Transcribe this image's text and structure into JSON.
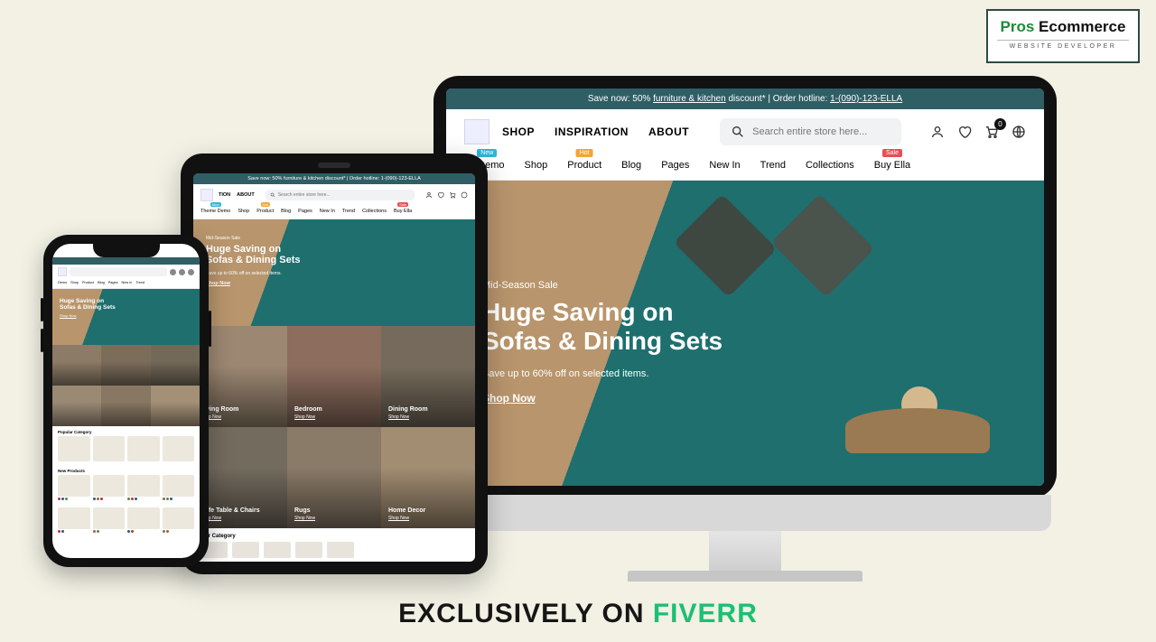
{
  "brand": {
    "word1": "Pros",
    "word2": " Ecommerce",
    "sub": "WEBSITE DEVELOPER"
  },
  "footer": {
    "pre": "EXCLUSIVELY ON ",
    "brand": "FIVERR"
  },
  "promo": {
    "pre": "Save now: 50% ",
    "link": "furniture & kitchen",
    "post": " discount* | Order hotline: ",
    "phone": "1-(090)-123-ELLA"
  },
  "nav": {
    "shop": "SHOP",
    "inspiration": "INSPIRATION",
    "about": "ABOUT"
  },
  "search": {
    "placeholder": "Search entire store here..."
  },
  "cart": {
    "count": "0"
  },
  "subnav": {
    "demo": "e Demo",
    "demo_badge": "New",
    "shop": "Shop",
    "product": "Product",
    "product_badge": "Hot",
    "blog": "Blog",
    "pages": "Pages",
    "newin": "New In",
    "trend": "Trend",
    "collections": "Collections",
    "buy": "Buy Ella",
    "buy_badge": "Sale"
  },
  "hero": {
    "kicker": "Mid-Season Sale",
    "title_l1": "Huge Saving on",
    "title_l2": "Sofas & Dining Sets",
    "sub": "Save up to 60% off on selected items.",
    "cta": "Shop Now"
  },
  "tablet": {
    "promo": "Save now: 50% furniture & kitchen discount* | Order hotline: 1-(090)-123-ELLA",
    "nav": {
      "tion": "TION",
      "about": "ABOUT"
    },
    "subnav": [
      "Theme Demo",
      "Shop",
      "Product",
      "Blog",
      "Pages",
      "New In",
      "Trend",
      "Collections",
      "Buy Ella"
    ],
    "cats": {
      "c1": "Living Room",
      "c2": "Bedroom",
      "c3": "Dining Room",
      "c4": "Cafe Table & Chairs",
      "c5": "Rugs",
      "c6": "Home Decor",
      "shop": "Shop Now"
    },
    "pop": "ular Category"
  },
  "phone": {
    "subnav": [
      "Demo",
      "Shop",
      "Product",
      "Blog",
      "Pages",
      "New In",
      "Trend"
    ],
    "section1": "Popular Category",
    "section2": "New Products"
  }
}
